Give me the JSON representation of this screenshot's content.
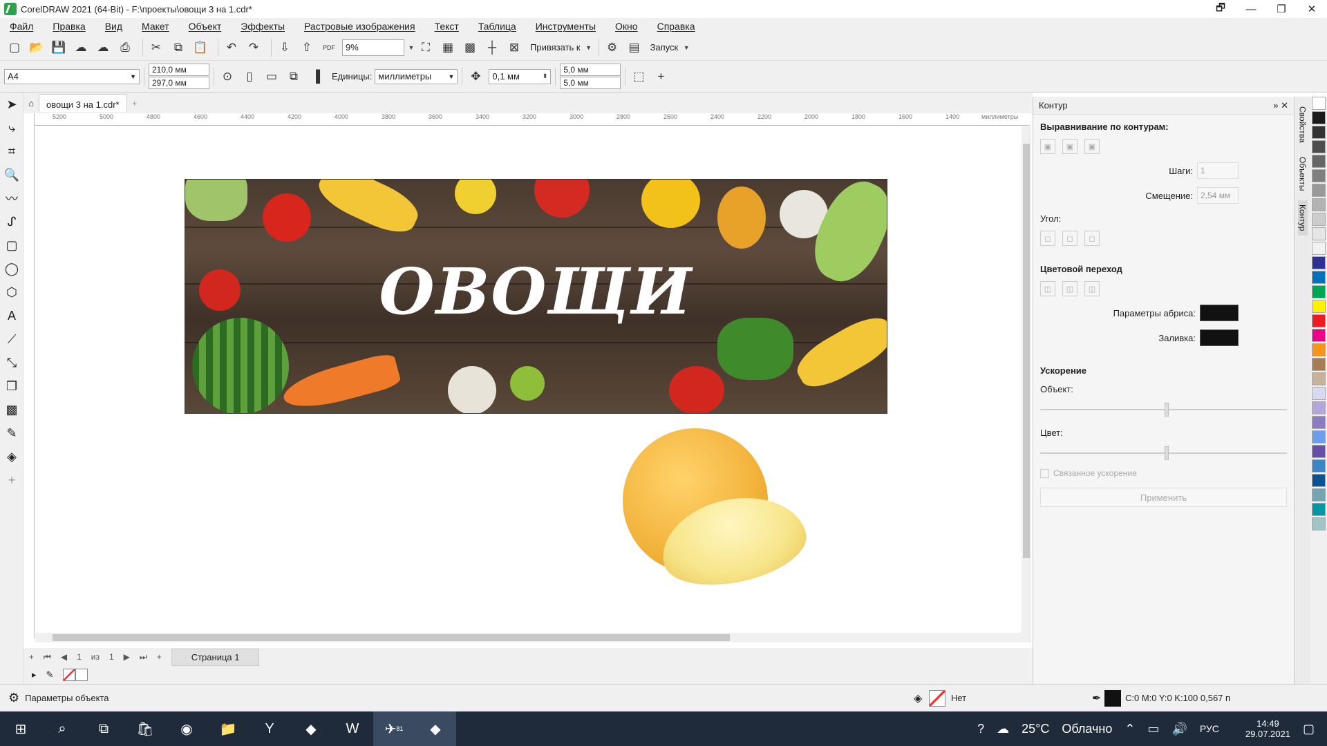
{
  "window": {
    "title": "CorelDRAW 2021 (64-Bit) - F:\\проекты\\овощи 3 на 1.cdr*",
    "min": "—",
    "max": "❐",
    "close": "✕",
    "help": "🗗"
  },
  "menu": [
    "Файл",
    "Правка",
    "Вид",
    "Макет",
    "Объект",
    "Эффекты",
    "Растровые изображения",
    "Текст",
    "Таблица",
    "Инструменты",
    "Окно",
    "Справка"
  ],
  "toolbar": {
    "zoom": "9%",
    "snap": "Привязать к",
    "launch": "Запуск",
    "pdf": "PDF"
  },
  "propbar": {
    "page_size": "A4",
    "width": "210,0 мм",
    "height": "297,0 мм",
    "units_label": "Единицы:",
    "units": "миллиметры",
    "nudge": "0,1 мм",
    "dup_x": "5,0 мм",
    "dup_y": "5,0 мм"
  },
  "doc_tab": "овощи 3 на 1.cdr*",
  "ruler": {
    "ticks": [
      "5200",
      "5000",
      "4800",
      "4600",
      "4400",
      "4200",
      "4000",
      "3800",
      "3600",
      "3400",
      "3200",
      "3000",
      "2800",
      "2600",
      "2400",
      "2200",
      "2000",
      "1800",
      "1600",
      "1400"
    ],
    "unit": "миллиметры"
  },
  "banner_text": "ОВОЩИ",
  "pager": {
    "current": "1",
    "of": "из",
    "total": "1",
    "tab": "Страница 1"
  },
  "status": {
    "object_params": "Параметры объекта",
    "fill": "Нет",
    "outline": "C:0 M:0 Y:0 K:100  0,567 п"
  },
  "panel": {
    "title": "Контур",
    "align_header": "Выравнивание по контурам:",
    "steps_label": "Шаги:",
    "steps": "1",
    "offset_label": "Смещение:",
    "offset": "2,54 мм",
    "angle_label": "Угол:",
    "blend_header": "Цветовой переход",
    "outline_params_label": "Параметры абриса:",
    "fill_label": "Заливка:",
    "accel_header": "Ускорение",
    "object_label": "Объект:",
    "color_label": "Цвет:",
    "linked_label": "Связанное ускорение",
    "apply": "Применить"
  },
  "sidetabs": [
    "Свойства",
    "Объекты",
    "Контур"
  ],
  "palette": [
    "#ffffff",
    "#1a1a1a",
    "#333333",
    "#4d4d4d",
    "#666666",
    "#808080",
    "#999999",
    "#b3b3b3",
    "#cccccc",
    "#e6e6e6",
    "#f2f2f2",
    "#2e3192",
    "#0072bc",
    "#00a651",
    "#fff200",
    "#ed1c24",
    "#ec008c",
    "#f7941d",
    "#a67c52",
    "#c7b299",
    "#d8d8f0",
    "#b4a7d6",
    "#8e7cc3",
    "#6d9eeb",
    "#674ea7",
    "#3d85c6",
    "#0b5394",
    "#76a5af",
    "#0097a7",
    "#a2c4c9"
  ],
  "taskbar": {
    "weather_temp": "25°C",
    "weather": "Облачно",
    "lang": "РУС",
    "time": "14:49",
    "date": "29.07.2021",
    "telegram_badge": "81"
  }
}
